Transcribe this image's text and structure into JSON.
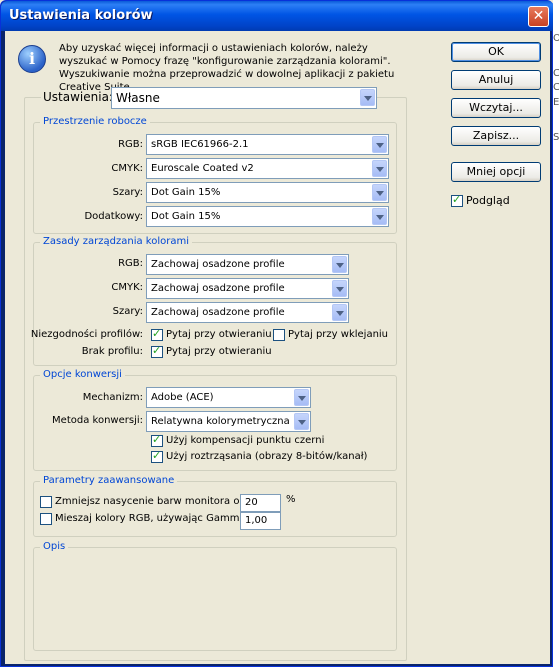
{
  "window": {
    "title": "Ustawienia kolorów",
    "close_glyph": "✕"
  },
  "info": {
    "icon": "info-icon",
    "icon_glyph": "i",
    "text": "Aby uzyskać więcej informacji o ustawieniach kolorów, należy wyszukać w Pomocy frazę \"konfigurowanie zarządzania kolorami\". Wyszukiwanie można przeprowadzić w dowolnej aplikacji z pakietu Creative Suite."
  },
  "settings": {
    "label": "Ustawienia:",
    "value": "Własne"
  },
  "working_spaces": {
    "title": "Przestrzenie robocze",
    "rgb": {
      "label": "RGB:",
      "value": "sRGB IEC61966-2.1"
    },
    "cmyk": {
      "label": "CMYK:",
      "value": "Euroscale Coated v2"
    },
    "gray": {
      "label": "Szary:",
      "value": "Dot Gain 15%"
    },
    "spot": {
      "label": "Dodatkowy:",
      "value": "Dot Gain 15%"
    }
  },
  "policies": {
    "title": "Zasady zarządzania kolorami",
    "rgb": {
      "label": "RGB:",
      "value": "Zachowaj osadzone profile"
    },
    "cmyk": {
      "label": "CMYK:",
      "value": "Zachowaj osadzone profile"
    },
    "gray": {
      "label": "Szary:",
      "value": "Zachowaj osadzone profile"
    },
    "mismatch_label": "Niezgodności profilów:",
    "mismatch_open": {
      "label": "Pytaj przy otwieraniu",
      "checked": true
    },
    "mismatch_paste": {
      "label": "Pytaj przy wklejaniu",
      "checked": false
    },
    "missing_label": "Brak profilu:",
    "missing_open": {
      "label": "Pytaj przy otwieraniu",
      "checked": true
    }
  },
  "conversion": {
    "title": "Opcje konwersji",
    "engine": {
      "label": "Mechanizm:",
      "value": "Adobe (ACE)"
    },
    "intent": {
      "label": "Metoda konwersji:",
      "value": "Relatywna kolorymetryczna"
    },
    "bpc": {
      "label": "Użyj kompensacji punktu czerni",
      "checked": true
    },
    "dither": {
      "label": "Użyj roztrząsania (obrazy 8-bitów/kanał)",
      "checked": true
    }
  },
  "advanced": {
    "title": "Parametry zaawansowane",
    "desaturate": {
      "label": "Zmniejsz nasycenie barw monitora o:",
      "value": "20",
      "unit": "%",
      "checked": false
    },
    "blend": {
      "label": "Mieszaj kolory RGB, używając Gamma:",
      "value": "1,00",
      "checked": false
    }
  },
  "description": {
    "title": "Opis"
  },
  "buttons": {
    "ok": "OK",
    "cancel": "Anuluj",
    "load": "Wczytaj...",
    "save": "Zapisz...",
    "fewer": "Mniej opcji"
  },
  "preview": {
    "label": "Podgląd",
    "checked": true
  },
  "edge_fragments": [
    "O",
    "C",
    "C",
    "E",
    "S"
  ]
}
